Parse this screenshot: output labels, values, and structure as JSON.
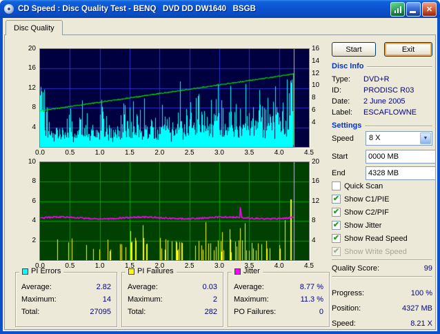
{
  "window": {
    "title": "CD Speed : Disc Quality Test - BENQ   DVD DD DW1640   BSGB"
  },
  "icons": {
    "close_glyph": "✕",
    "combo_arrow_glyph": "▼",
    "checkbox_check_glyph": "✔"
  },
  "tab": {
    "label": "Disc Quality"
  },
  "toolbar": {
    "start_label": "Start",
    "exit_label": "Exit"
  },
  "chart_data": [
    {
      "type": "bar",
      "name": "PI Errors / Read Speed",
      "x_unit": "GB",
      "x_ticks": [
        "0.0",
        "0.5",
        "1.0",
        "1.5",
        "2.0",
        "2.5",
        "3.0",
        "3.5",
        "4.0",
        "4.5"
      ],
      "x_max": 4.5,
      "data_end_gb": 4.23,
      "left_axis": {
        "label": "PI Errors",
        "min": 0,
        "max": 20,
        "ticks": [
          20,
          16,
          12,
          8,
          4
        ]
      },
      "right_axis": {
        "label": "Read Speed (X)",
        "min": 0,
        "max": 16,
        "ticks": [
          16,
          14,
          12,
          10,
          8,
          6,
          4
        ]
      },
      "bars": {
        "series": "PI Errors",
        "color": "#00FFFF",
        "average": 2.82,
        "maximum": 14,
        "total": 27095
      },
      "line": {
        "series": "Read Speed",
        "color": "#00E000",
        "start_speed_x": 5.9,
        "end_speed_x": 11.9
      },
      "bg": "#000040",
      "grid": "#2830C8",
      "seed": 101
    },
    {
      "type": "bar",
      "name": "PI Failures / Jitter",
      "x_unit": "GB",
      "x_ticks": [
        "0.0",
        "0.5",
        "1.0",
        "1.5",
        "2.0",
        "2.5",
        "3.0",
        "3.5",
        "4.0",
        "4.5"
      ],
      "x_max": 4.5,
      "data_end_gb": 4.23,
      "left_axis": {
        "label": "PI Failures",
        "min": 0,
        "max": 10,
        "ticks": [
          10,
          8,
          6,
          4,
          2
        ]
      },
      "right_axis": {
        "label": "Jitter %",
        "min": 0,
        "max": 20,
        "ticks": [
          20,
          16,
          12,
          8,
          4
        ]
      },
      "bars": {
        "series": "PI Failures",
        "color": "#FFFF00",
        "average": 0.03,
        "maximum": 2,
        "total": 282
      },
      "line": {
        "series": "Jitter",
        "color": "#FF00FF",
        "average_pct": 8.77,
        "maximum_pct": 11.3,
        "spike_x": 3.35
      },
      "bg": "#004000",
      "grid": "#00A000",
      "seed": 202
    }
  ],
  "legend": {
    "boxes": [
      {
        "title": "PI Errors",
        "swatch": "#00FFFF",
        "rows": [
          {
            "label": "Average:",
            "value": "2.82"
          },
          {
            "label": "Maximum:",
            "value": "14"
          },
          {
            "label": "Total:",
            "value": "27095"
          }
        ]
      },
      {
        "title": "PI Failures",
        "swatch": "#FFFF00",
        "rows": [
          {
            "label": "Average:",
            "value": "0.03"
          },
          {
            "label": "Maximum:",
            "value": "2"
          },
          {
            "label": "Total:",
            "value": "282"
          }
        ]
      },
      {
        "title": "Jitter",
        "swatch": "#FF00FF",
        "rows": [
          {
            "label": "Average:",
            "value": "8.77 %"
          },
          {
            "label": "Maximum:",
            "value": "11.3 %"
          },
          {
            "label": "PO Failures:",
            "value": "0"
          }
        ]
      }
    ]
  },
  "sidebar": {
    "disc_info": {
      "title": "Disc Info",
      "rows": [
        {
          "label": "Type:",
          "value": "DVD+R"
        },
        {
          "label": "ID:",
          "value": "PRODISC R03"
        },
        {
          "label": "Date:",
          "value": "2 June 2005"
        },
        {
          "label": "Label:",
          "value": "ESCAFLOWNE"
        }
      ]
    },
    "settings": {
      "title": "Settings",
      "speed_label": "Speed",
      "speed_value": "8 X",
      "start_label": "Start",
      "start_value": "0000 MB",
      "end_label": "End",
      "end_value": "4328 MB",
      "checkboxes": [
        {
          "label": "Quick Scan",
          "checked": false,
          "enabled": true
        },
        {
          "label": "Show C1/PIE",
          "checked": true,
          "enabled": true
        },
        {
          "label": "Show C2/PIF",
          "checked": true,
          "enabled": true
        },
        {
          "label": "Show Jitter",
          "checked": true,
          "enabled": true
        },
        {
          "label": "Show Read Speed",
          "checked": true,
          "enabled": true
        },
        {
          "label": "Show Write Speed",
          "checked": true,
          "enabled": false
        }
      ]
    },
    "quality": {
      "label": "Quality Score:",
      "value": "99"
    },
    "progress": [
      {
        "label": "Progress:",
        "value": "100 %"
      },
      {
        "label": "Position:",
        "value": "4327 MB"
      },
      {
        "label": "Speed:",
        "value": "8.21 X"
      }
    ]
  }
}
